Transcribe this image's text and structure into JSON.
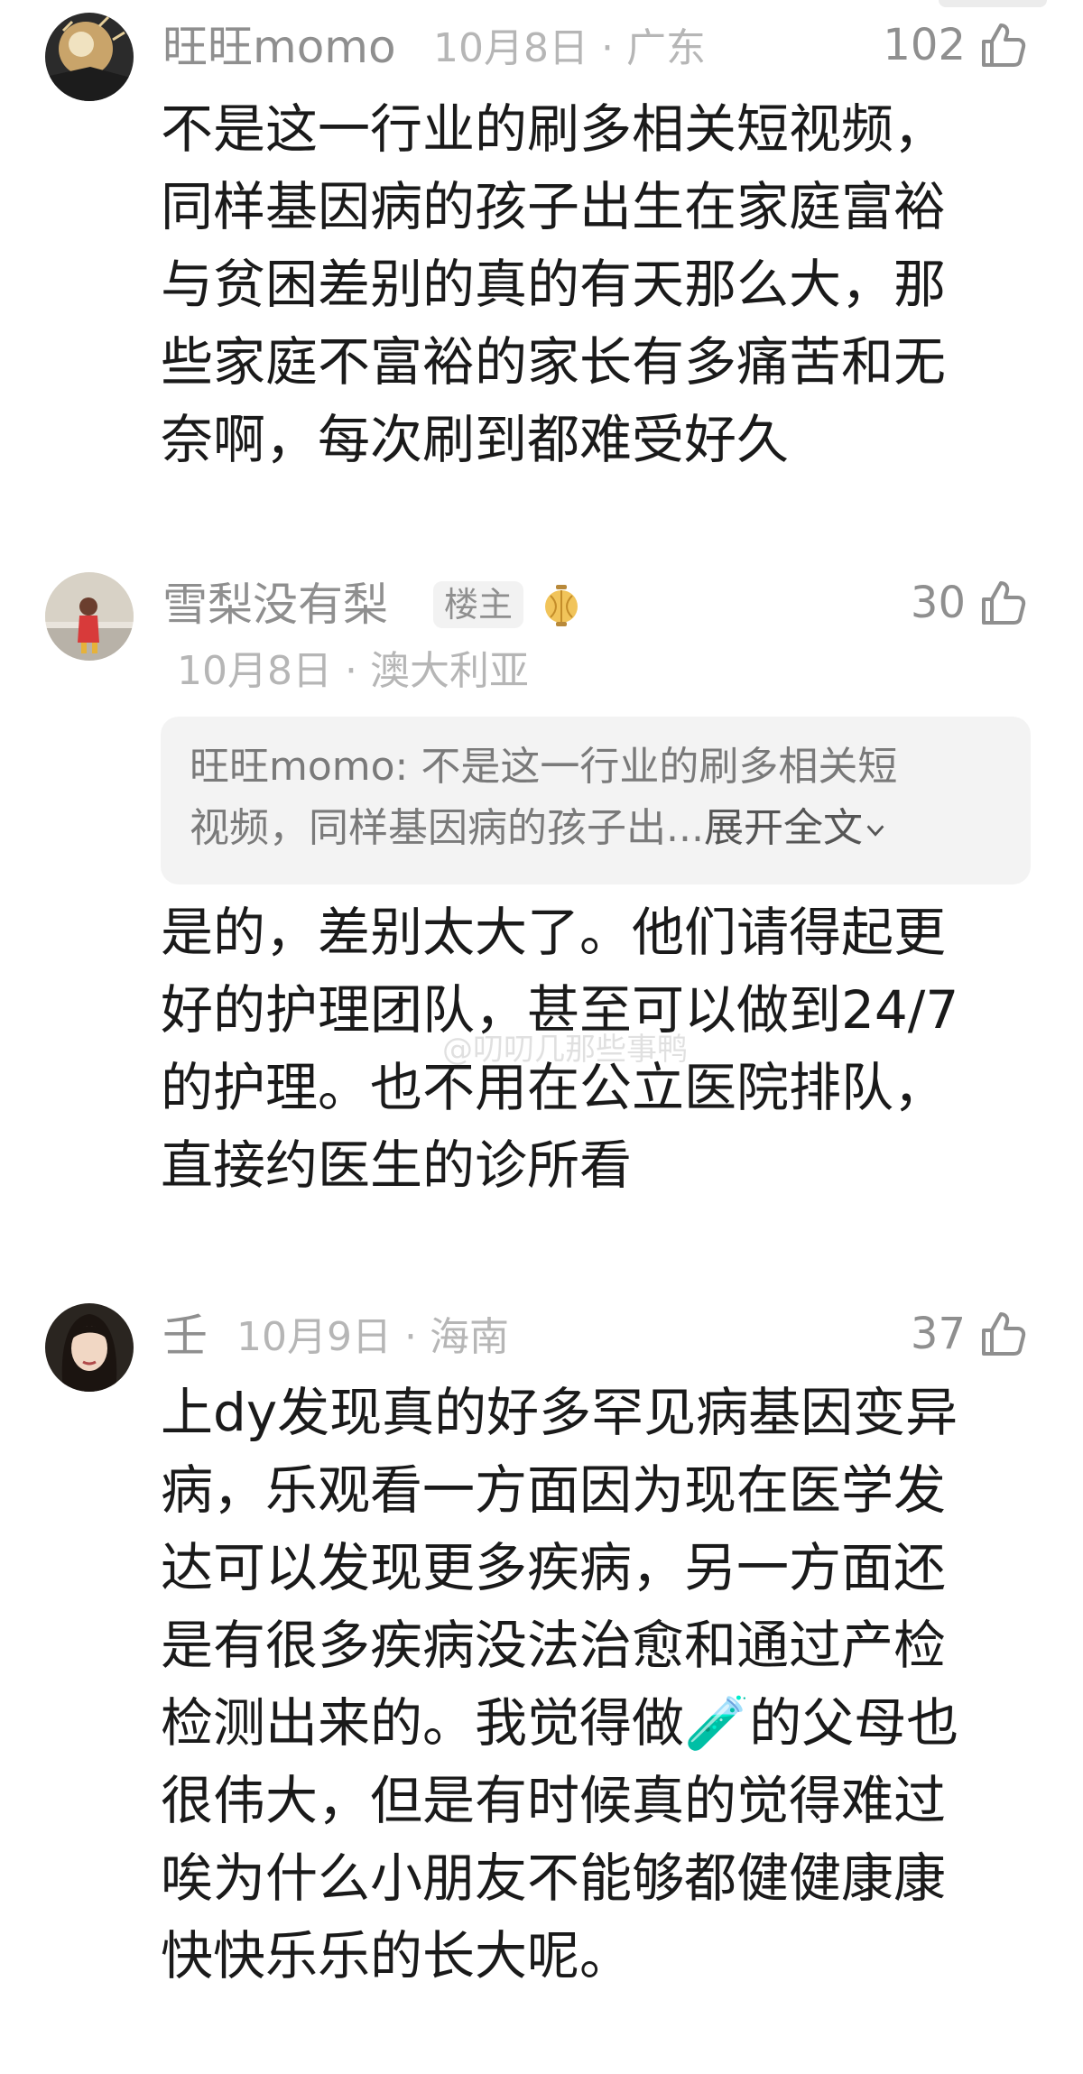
{
  "comments": [
    {
      "username": "旺旺momo",
      "date_location": "10月8日 · 广东",
      "likes": "102",
      "text": "不是这一行业的刷多相关短视频，\n同样基因病的孩子出生在家庭富裕\n与贫困差别的真的有天那么大，那\n些家庭不富裕的家长有多痛苦和无\n奈啊，每次刷到都难受好久"
    },
    {
      "username": "雪梨没有梨",
      "badge": "楼主",
      "date_location": "10月8日 · 澳大利亚",
      "likes": "30",
      "quote": "旺旺momo: 不是这一行业的刷多相关短\n视频，同样基因病的孩子出...",
      "quote_expand": "展开全文",
      "text": "是的，差别太大了。他们请得起更\n好的护理团队，甚至可以做到24/7\n的护理。也不用在公立医院排队，\n直接约医生的诊所看"
    },
    {
      "username": "壬",
      "date_location": "10月9日 · 海南",
      "likes": "37",
      "text": "上dy发现真的好多罕见病基因变异\n病，乐观看一方面因为现在医学发\n达可以发现更多疾病，另一方面还\n是有很多疾病没法治愈和通过产检\n检测出来的。我觉得做🧪的父母也\n很伟大，但是有时候真的觉得难过\n唉为什么小朋友不能够都健健康康\n快快乐乐的长大呢。"
    }
  ],
  "watermark": "@叨叨几那些事鸭",
  "colors": {
    "muted": "#8f8f8f",
    "meta": "#b6b6b6",
    "text": "#1a1a1a",
    "quote_bg": "#f3f3f3"
  },
  "icons": [
    "thumbs-up-icon",
    "lantern-icon",
    "chevron-down-icon"
  ]
}
